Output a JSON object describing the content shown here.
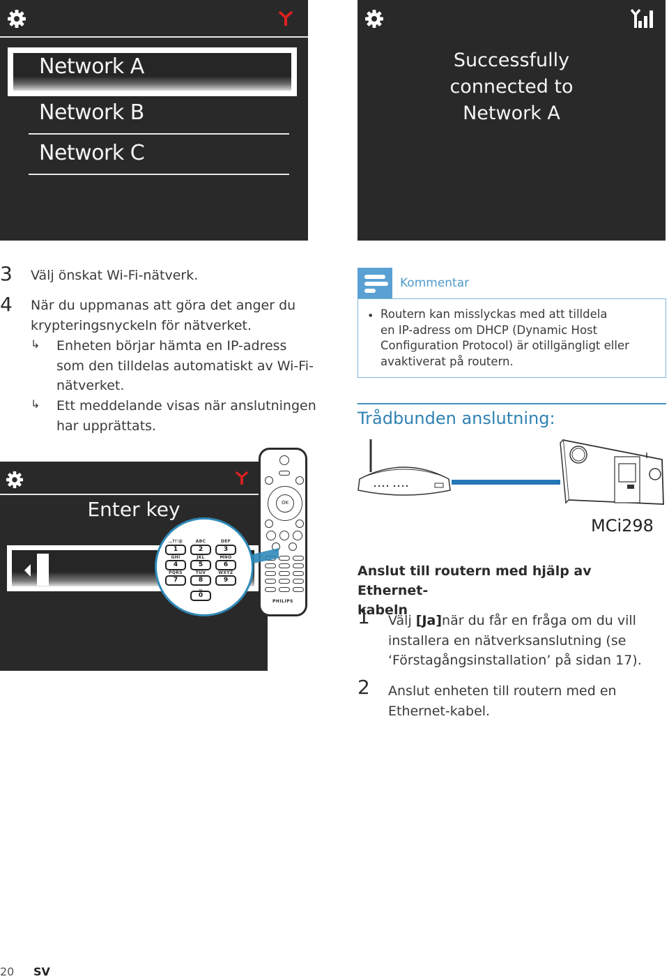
{
  "screens": {
    "network_list": {
      "settings_icon": "gear-icon",
      "signal_icon": "antenna-no-signal-icon",
      "signal_icon_color": "#e02020",
      "items": [
        {
          "label": "Network A",
          "selected": true
        },
        {
          "label": "Network B",
          "selected": false
        },
        {
          "label": "Network C",
          "selected": false
        }
      ]
    },
    "connected": {
      "settings_icon": "gear-icon",
      "signal_icon": "signal-strength-icon",
      "message_lines": [
        "Successfully",
        "connected to",
        "Network A"
      ]
    },
    "enter_key": {
      "settings_icon": "gear-icon",
      "signal_icon": "antenna-no-signal-icon",
      "title": "Enter key",
      "input_value": ""
    }
  },
  "keypad": {
    "keys": [
      {
        "digit": "1",
        "letters": ".,?!'@"
      },
      {
        "digit": "2",
        "letters": "ABC"
      },
      {
        "digit": "3",
        "letters": "DEF"
      },
      {
        "digit": "4",
        "letters": "GHI"
      },
      {
        "digit": "5",
        "letters": "JKL"
      },
      {
        "digit": "6",
        "letters": "MNO"
      },
      {
        "digit": "7",
        "letters": "PQRS"
      },
      {
        "digit": "8",
        "letters": "TUV"
      },
      {
        "digit": "9",
        "letters": "WXYZ"
      },
      {
        "digit": "0",
        "letters": "␣"
      }
    ]
  },
  "remote": {
    "ok_label": "OK",
    "brand": "PHILIPS"
  },
  "steps_left": [
    {
      "number": "3",
      "text": "Välj önskat Wi-Fi-nätverk."
    },
    {
      "number": "4",
      "text_lines": [
        "När du uppmanas att göra det anger du",
        "krypteringsnyckeln för nätverket."
      ]
    }
  ],
  "results": [
    {
      "icon": "result-arrow-icon",
      "lines": [
        "Enheten börjar hämta en IP-adress",
        "som den tilldelas automatiskt av Wi-Fi-",
        "nätverket."
      ]
    },
    {
      "icon": "result-arrow-icon",
      "lines": [
        "Ett meddelande visas när anslutningen",
        "har upprättats."
      ]
    }
  ],
  "note": {
    "title": "Kommentar",
    "bullet_lines": [
      "Routern kan misslyckas med att tilldela",
      "en IP-adress om DHCP (Dynamic Host",
      "Configuration Protocol) är otillgängligt eller",
      "avaktiverat på routern."
    ]
  },
  "section": {
    "title": "Trådbunden anslutning:",
    "model": "MCi298",
    "subhead_lines": [
      "Anslut till routern med hjälp av Ethernet-",
      "kabeln"
    ]
  },
  "steps_right": [
    {
      "number": "1",
      "prefix": "Välj ",
      "bold": "[Ja]",
      "rest_lines": [
        "när du får en fråga om du vill",
        "installera en nätverksanslutning (se",
        "‘Förstagångsinstallation’ på sidan 17)."
      ]
    },
    {
      "number": "2",
      "lines": [
        "Anslut enheten till routern med en",
        "Ethernet-kabel."
      ]
    }
  ],
  "footer": {
    "page_number": "20",
    "language": "SV"
  },
  "colors": {
    "screen_bg": "#2a2929",
    "accent_blue": "#2f82b3",
    "note_blue": "#5aa0d4",
    "cable_blue": "#2577b6",
    "antenna_red": "#e02020"
  }
}
